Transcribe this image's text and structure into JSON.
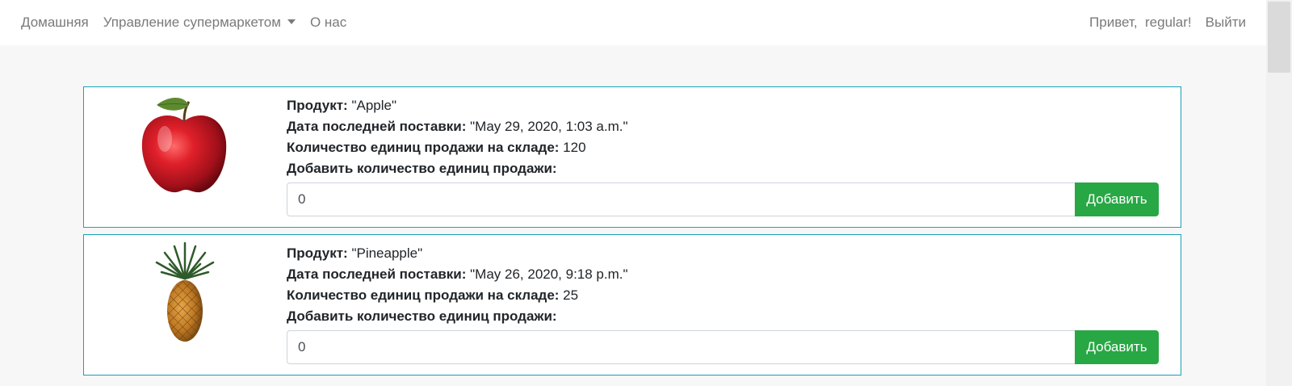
{
  "navbar": {
    "home": "Домашняя",
    "management": "Управление супермаркетом",
    "about": "О нас",
    "greeting": "Привет,  regular!",
    "logout": "Выйти"
  },
  "products": [
    {
      "product_label": "Продукт:",
      "product_value": " \"Apple\"",
      "delivery_label": "Дата последней поставки:",
      "delivery_value": " \"May 29, 2020, 1:03 a.m.\"",
      "stock_label": "Количество единиц продажи на складе:",
      "stock_value": " 120",
      "add_label": "Добавить количество единиц продажи:",
      "input_value": "0",
      "button_label": "Добавить",
      "image_icon": "apple-image"
    },
    {
      "product_label": "Продукт:",
      "product_value": " \"Pineapple\"",
      "delivery_label": "Дата последней поставки:",
      "delivery_value": " \"May 26, 2020, 9:18 p.m.\"",
      "stock_label": "Количество единиц продажи на складе:",
      "stock_value": " 25",
      "add_label": "Добавить количество единиц продажи:",
      "input_value": "0",
      "button_label": "Добавить",
      "image_icon": "pineapple-image"
    }
  ],
  "colors": {
    "card_border": "#17a2b8",
    "button": "#28a745",
    "nav_text": "#7a7a7a"
  }
}
